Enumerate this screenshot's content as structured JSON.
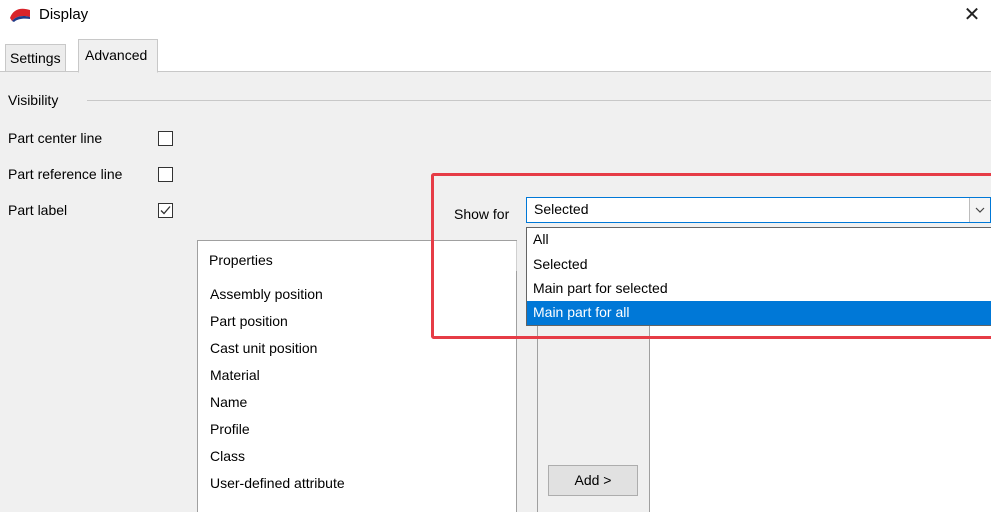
{
  "window": {
    "title": "Display",
    "close_glyph": "✕"
  },
  "tabs": [
    {
      "label": "Settings",
      "active": false
    },
    {
      "label": "Advanced",
      "active": true
    }
  ],
  "visibility": {
    "group_label": "Visibility",
    "rows": [
      {
        "label": "Part center line",
        "checked": false
      },
      {
        "label": "Part reference line",
        "checked": false
      },
      {
        "label": "Part label",
        "checked": true
      }
    ]
  },
  "show_for": {
    "label": "Show for",
    "selected_value": "Selected",
    "options": [
      "All",
      "Selected",
      "Main part for selected",
      "Main part for all"
    ],
    "highlighted_option": "Main part for all"
  },
  "properties": {
    "header": "Properties",
    "items": [
      "Assembly position",
      "Part position",
      "Cast unit position",
      "Material",
      "Name",
      "Profile",
      "Class",
      "User-defined attribute"
    ]
  },
  "add_button_label": "Add >",
  "colors": {
    "accent": "#0078d7",
    "annotation_highlight": "#e63c46",
    "app_icon_red": "#d8232a"
  },
  "icons": {
    "app": "display-app-icon",
    "close": "close-icon",
    "dropdown": "chevron-down-icon",
    "check": "checkmark-icon"
  }
}
